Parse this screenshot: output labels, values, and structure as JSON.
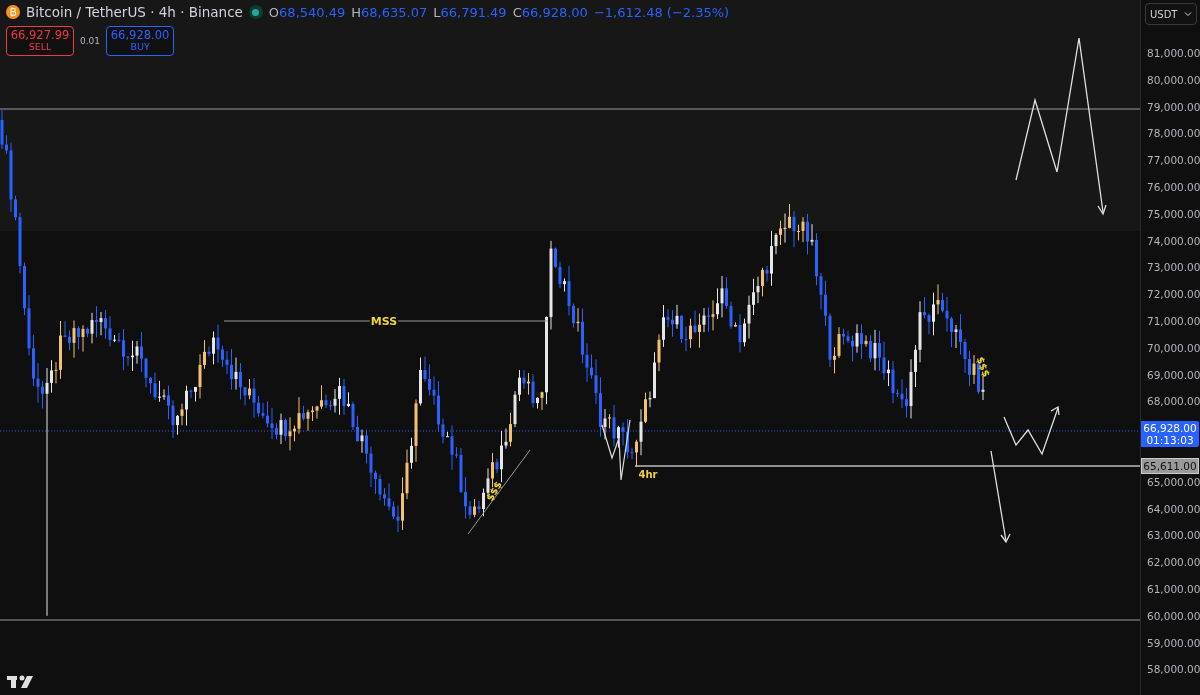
{
  "header": {
    "symbol_title": "Bitcoin / TetherUS · 4h · Binance",
    "market_open": true,
    "ohlc": [
      {
        "label": "O",
        "value": "68,540.49"
      },
      {
        "label": "H",
        "value": "68,635.07"
      },
      {
        "label": "L",
        "value": "66,791.49"
      },
      {
        "label": "C",
        "value": "66,928.00"
      }
    ],
    "change": "−1,612.48 (−2.35%)"
  },
  "trade": {
    "sell_price": "66,927.99",
    "sell_label": "SELL",
    "spread": "0.01",
    "buy_price": "66,928.00",
    "buy_label": "BUY"
  },
  "currency_select": {
    "value": "USDT"
  },
  "price_axis": {
    "labels": [
      "81,000.00",
      "80,000.00",
      "79,000.00",
      "78,000.00",
      "77,000.00",
      "76,000.00",
      "75,000.00",
      "74,000.00",
      "73,000.00",
      "72,000.00",
      "71,000.00",
      "70,000.00",
      "69,000.00",
      "68,000.00",
      "65,000.00",
      "64,000.00",
      "63,000.00",
      "62,000.00",
      "61,000.00",
      "60,000.00",
      "59,000.00",
      "58,000.00"
    ],
    "current_price": "66,928.00",
    "countdown": "01:13:03",
    "level_label": "65,611.00"
  },
  "annotations": [
    {
      "kind": "label",
      "text": "MSS"
    },
    {
      "kind": "label",
      "text": "$$$"
    },
    {
      "kind": "label",
      "text": "$$$"
    },
    {
      "kind": "label",
      "text": "4hr"
    }
  ]
}
